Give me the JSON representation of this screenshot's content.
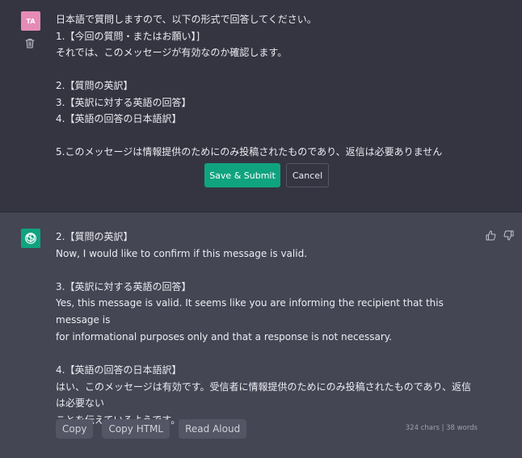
{
  "user": {
    "avatar_initials": "TA",
    "lines": [
      "日本語で質問しますので、以下の形式で回答してください。",
      "1.【今回の質問・またはお願い】]",
      "それでは、このメッセージが有効なのか確認します。",
      "",
      "2.【質問の英訳】",
      "3.【英訳に対する英語の回答】",
      "4.【英語の回答の日本語訳】",
      "",
      "5.このメッセージは情報提供のためにのみ投稿されたものであり、返信は必要ありません"
    ],
    "save_label": "Save & Submit",
    "cancel_label": "Cancel"
  },
  "assistant": {
    "p1_line1": "2.【質問の英訳】",
    "p1_line2": "Now, I would like to confirm if this message is valid.",
    "p2_line1": "3.【英訳に対する英語の回答】",
    "p2_line2": "Yes, this message is valid. It seems like you are informing the recipient that this message is",
    "p2_line3": "for informational purposes only and that a response is not necessary.",
    "p3_line1": "4.【英語の回答の日本語訳】",
    "p3_line2": "はい、このメッセージは有効です。受信者に情報提供のためにのみ投稿されたものであり、返信は必要ない",
    "p3_line3": "ことを伝えているようです。"
  },
  "toolbar": {
    "copy": "Copy",
    "copy_html": "Copy HTML",
    "read_aloud": "Read Aloud",
    "stats": "324 chars | 38 words"
  },
  "colors": {
    "accent": "#10a37f",
    "user_bg": "#343541",
    "assistant_bg": "#444654",
    "user_avatar": "#e58bb6"
  },
  "icons": {
    "trash": "trash-icon",
    "bot": "openai-logo-icon",
    "thumbs_up": "thumbs-up-icon",
    "thumbs_down": "thumbs-down-icon"
  }
}
